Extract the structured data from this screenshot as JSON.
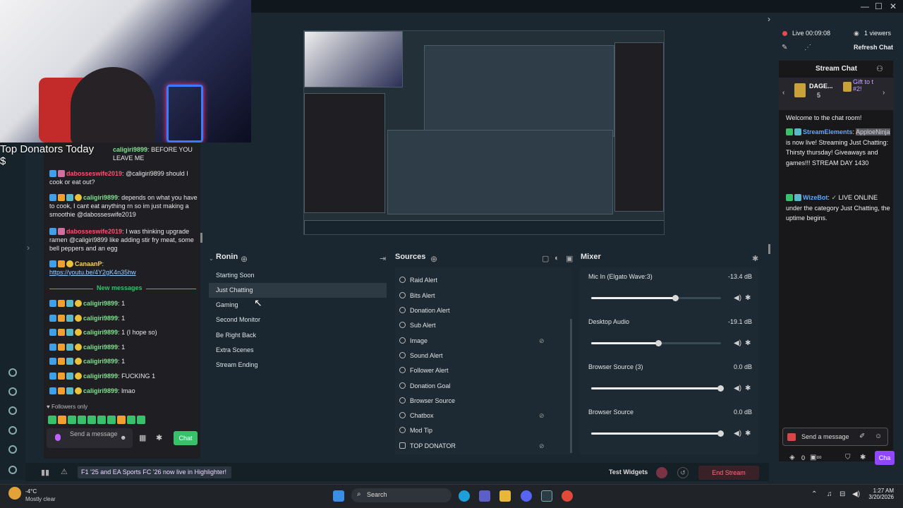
{
  "webcam_overlay": {
    "top_donators_label": "Top Donators Today",
    "amount": "$"
  },
  "left_chat": {
    "messages": [
      {
        "user": "caligiri9899",
        "text": "BEFORE YOU LEAVE ME"
      },
      {
        "user": "dabosseswife2019",
        "text": "@caligiri9899 should I cook or eat out?"
      },
      {
        "user": "caligiri9899",
        "text": "depends on what you have to cook, I cant eat anything rn so im just making a smoothie @dabosseswife2019"
      },
      {
        "user": "dabosseswife2019",
        "text": "I was thinking upgrade ramen @caligiri9899 like adding stir fry meat, some bell peppers and an egg"
      },
      {
        "user": "CanaanP",
        "text": "https://youtu.be/4Y2gK4n35hw"
      }
    ],
    "divider_label": "New messages",
    "new_messages": [
      {
        "user": "caligiri9899",
        "text": "1"
      },
      {
        "user": "caligiri9899",
        "text": "1"
      },
      {
        "user": "caligiri9899",
        "text": "1 (I hope so)"
      },
      {
        "user": "caligiri9899",
        "text": "1"
      },
      {
        "user": "caligiri9899",
        "text": "1"
      },
      {
        "user": "caligiri9899",
        "text": "FUCKING 1"
      },
      {
        "user": "caligiri9899",
        "text": "lmao"
      }
    ],
    "followers_only": "Followers only",
    "send_placeholder": "Send a message",
    "chat_button": "Chat"
  },
  "scenes": {
    "title": "Ronin",
    "items": [
      "Starting Soon",
      "Just Chatting",
      "Gaming",
      "Second Monitor",
      "Be Right Back",
      "Extra Scenes",
      "Stream Ending"
    ],
    "active_index": 1
  },
  "sources": {
    "title": "Sources",
    "items": [
      "Raid Alert",
      "Bits Alert",
      "Donation Alert",
      "Sub Alert",
      "Image",
      "Sound Alert",
      "Follower Alert",
      "Donation Goal",
      "Browser Source",
      "Chatbox",
      "Mod Tip",
      "TOP DONATOR"
    ]
  },
  "mixer": {
    "title": "Mixer",
    "tracks": [
      {
        "name": "Mic In (Elgato Wave:3)",
        "db": "-13.4 dB",
        "level": 0.65
      },
      {
        "name": "Desktop Audio",
        "db": "-19.1 dB",
        "level": 0.52
      },
      {
        "name": "Browser Source (3)",
        "db": "0.0 dB",
        "level": 1.0
      },
      {
        "name": "Browser Source",
        "db": "0.0 dB",
        "level": 1.0
      }
    ]
  },
  "bottom_bar": {
    "banner": "F1 '25 and EA Sports FC '26 now live in Highlighter!",
    "test_widgets": "Test Widgets",
    "end_stream": "End Stream"
  },
  "right_panel": {
    "live_status": "Live 00:09:08",
    "viewers": "1 viewers",
    "refresh_chat": "Refresh Chat",
    "stream_chat_title": "Stream Chat",
    "gift_user": "DAGE...",
    "gift_count": "5",
    "gift_label": "Gift to t #2!",
    "welcome": "Welcome to the chat room!",
    "msg1_user": "StreamElements",
    "msg1_highlight": "ApploeNinja",
    "msg1_text": "is now live! Streaming Just Chatting: Thirsty thursday! Giveaways and games!!! STREAM DAY 1430",
    "msg2_user": "WizeBot",
    "msg2_text": "LIVE ONLINE under the category Just Chatting, the uptime begins.",
    "send_placeholder": "Send a message",
    "points": "0",
    "chat_button": "Cha"
  },
  "taskbar": {
    "weather_temp": "-4°C",
    "weather_desc": "Mostly clear",
    "search": "Search",
    "time": "1:27 AM",
    "date": "3/20/2026"
  },
  "colors": {
    "accent_purple": "#9147ff",
    "end_stream_red": "#ff6f7f",
    "live_red": "#e34c4c",
    "new_messages_green": "#39c06b"
  }
}
